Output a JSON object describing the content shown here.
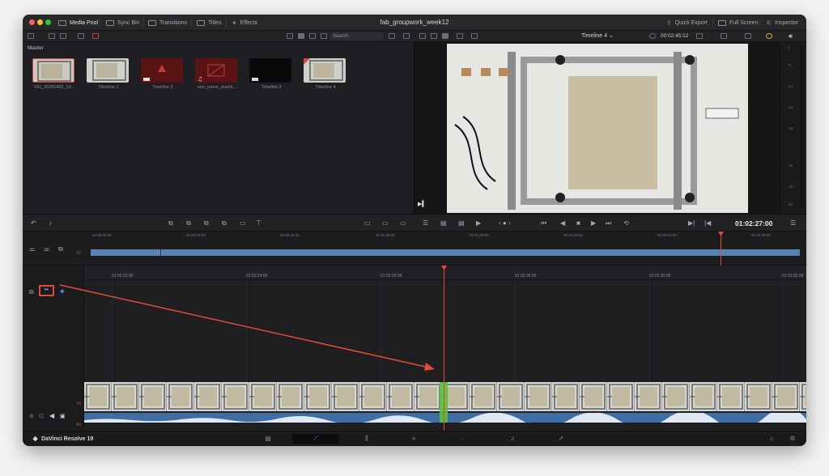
{
  "topbar": {
    "media_pool": "Media Pool",
    "sync_bin": "Sync Bin",
    "transitions": "Transitions",
    "titles": "Titles",
    "effects": "Effects",
    "project_title": "fab_groupwork_week12",
    "quick_export": "Quick Export",
    "full_screen": "Full Screen",
    "inspector": "Inspector"
  },
  "toolbar2": {
    "search_placeholder": "Search",
    "timeline_name": "Timeline 4",
    "source_timecode": "00:02:45:12"
  },
  "media_pool": {
    "bin": "Master",
    "clips": [
      {
        "label": "VID_20250420_19..."
      },
      {
        "label": "Timeline 1"
      },
      {
        "label": "Timeline 2"
      },
      {
        "label": "neo_move_machi..."
      },
      {
        "label": "Timeline 3"
      },
      {
        "label": "Timeline 4"
      }
    ]
  },
  "meters": {
    "labels": [
      "0",
      "-5",
      "-10",
      "-15",
      "-20",
      "-30",
      "-40",
      "-50"
    ]
  },
  "transport": {
    "timecode": "01:02:27:00"
  },
  "upper_timeline": {
    "ticks": [
      "01:00:00:00",
      "01:00:22:00",
      "01:00:44:00",
      "01:01:06:00",
      "01:01:28:00",
      "01:01:50:00",
      "01:02:12:00",
      "01:02:34:00"
    ],
    "track": "V1"
  },
  "lower_timeline": {
    "ticks": [
      "01:02:22:00",
      "01:02:24:00",
      "01:02:26:00",
      "01:02:28:00",
      "01:02:30:00",
      "01:02:32:00"
    ],
    "video_track": "V1",
    "audio_track": "A1"
  },
  "bottombar": {
    "brand": "DaVinci Resolve 19"
  },
  "colors": {
    "accent": "#e24a3e",
    "clip_blue": "#5b82b5",
    "cut_green": "#56c23a"
  }
}
